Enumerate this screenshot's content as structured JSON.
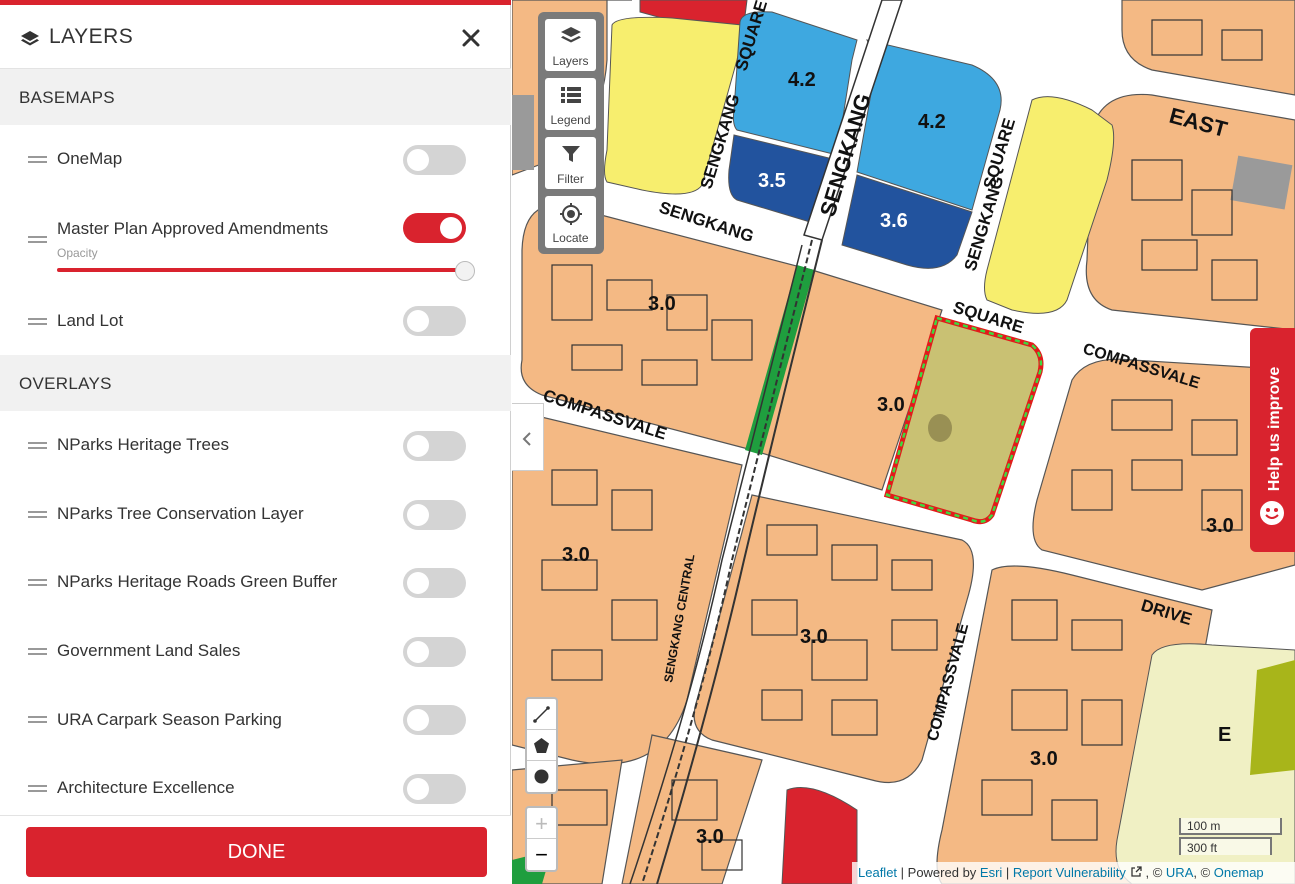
{
  "panel": {
    "title": "LAYERS",
    "title_icon": "layers-icon",
    "close_icon": "close-icon",
    "basemaps_heading": "BASEMAPS",
    "basemaps": [
      {
        "label": "OneMap",
        "enabled": false
      },
      {
        "label": "Master Plan Approved Amendments",
        "enabled": true,
        "opacity_label": "Opacity",
        "opacity": 1.0
      },
      {
        "label": "Land Lot",
        "enabled": false
      }
    ],
    "overlays_heading": "OVERLAYS",
    "overlays": [
      {
        "label": "NParks Heritage Trees",
        "enabled": false
      },
      {
        "label": "NParks Tree Conservation Layer",
        "enabled": false
      },
      {
        "label": "NParks Heritage Roads Green Buffer",
        "enabled": false
      },
      {
        "label": "Government Land Sales",
        "enabled": false
      },
      {
        "label": "URA Carpark Season Parking",
        "enabled": false
      },
      {
        "label": "Architecture Excellence",
        "enabled": false
      }
    ],
    "done_label": "DONE"
  },
  "map": {
    "toolbox": [
      {
        "label": "Layers",
        "icon": "layers-icon"
      },
      {
        "label": "Legend",
        "icon": "legend-icon"
      },
      {
        "label": "Filter",
        "icon": "filter-icon"
      },
      {
        "label": "Locate",
        "icon": "locate-icon"
      }
    ],
    "draw_tools": [
      "polyline-icon",
      "polygon-icon",
      "circle-icon"
    ],
    "zoom_in": "+",
    "zoom_out": "−",
    "help_label": "Help us improve",
    "scale": {
      "metric": "100 m",
      "imperial": "300 ft"
    },
    "attribution": {
      "leaflet": "Leaflet",
      "powered_by": " | Powered by ",
      "esri": "Esri",
      "sep": " | ",
      "report": "Report Vulnerability",
      "copy1": " , © ",
      "ura": "URA",
      "copy2": ", © ",
      "onemap": "Onemap"
    },
    "road_labels": {
      "square_top": "SQUARE",
      "sengkang_left": "SENGKANG",
      "sengkang_main": "SENGKANG",
      "sengkang_diag": "SENGKANG",
      "square_right": "SQUARE",
      "sengkang_right": "SENGKANG",
      "east": "EAST",
      "square_mid": "SQUARE",
      "compassvale_right": "COMPASSVALE",
      "compassvale_left": "COMPASSVALE",
      "sengkang_central": "SENGKANG CENTRAL",
      "drive": "DRIVE",
      "compassvale_bottom": "COMPASSVALE"
    },
    "plot_ratios": {
      "a": "4.2",
      "b": "4.2",
      "c": "3.5",
      "d": "3.6",
      "e": "3.0",
      "f": "3.0",
      "g": "3.0",
      "h": "3.0",
      "i": "3.0",
      "j": "3.0",
      "k": "3.0",
      "l": "E"
    },
    "colors": {
      "residential": "#f4b984",
      "commercial_light": "#3ea8e0",
      "commercial_dark": "#22539e",
      "business": "#f7ee6e",
      "park": "#1f9e3e",
      "red_zone": "#d9232e",
      "selected_site": "#c9c173"
    }
  }
}
